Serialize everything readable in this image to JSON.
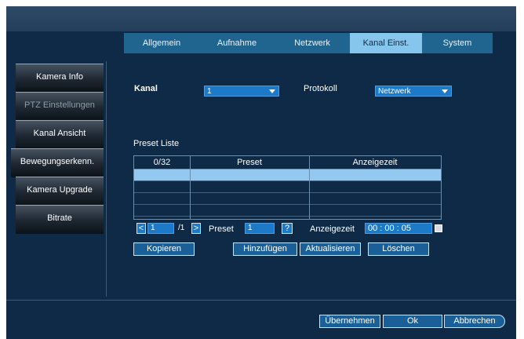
{
  "tabs": [
    {
      "label": "Allgemein",
      "active": false
    },
    {
      "label": "Aufnahme",
      "active": false
    },
    {
      "label": "Netzwerk",
      "active": false
    },
    {
      "label": "Kanal Einst.",
      "active": true
    },
    {
      "label": "System",
      "active": false
    }
  ],
  "sidebar": {
    "items": [
      {
        "label": "Kamera Info",
        "enabled": true
      },
      {
        "label": "PTZ Einstellungen",
        "enabled": false
      },
      {
        "label": "Kanal Ansicht",
        "enabled": true
      },
      {
        "label": "Bewegungserkenn.",
        "enabled": true
      },
      {
        "label": "Kamera Upgrade",
        "enabled": true
      },
      {
        "label": "Bitrate",
        "enabled": true
      }
    ]
  },
  "form": {
    "kanal_label": "Kanal",
    "kanal_value": "1",
    "protokoll_label": "Protokoll",
    "protokoll_value": "Netzwerk"
  },
  "preset_list": {
    "title": "Preset Liste",
    "headers": [
      "0/32",
      "Preset",
      "Anzeigezeit"
    ],
    "row_count": 4,
    "selected_row": 0
  },
  "pager": {
    "prev": "<",
    "page_value": "1",
    "total": "/1",
    "next": ">",
    "preset_label": "Preset",
    "preset_value": "1",
    "help": "?",
    "anzeigezeit_label": "Anzeigezeit",
    "time_value": "00 : 00 : 05"
  },
  "actions": {
    "kopieren": "Kopieren",
    "hinzufuegen": "Hinzufügen",
    "aktualisieren": "Aktualisieren",
    "loeschen": "Löschen"
  },
  "footer": {
    "apply": "Übernehmen",
    "ok": "Ok",
    "cancel": "Abbrechen"
  },
  "colors": {
    "background": "#0e2a46",
    "tab_bar": "#1f6590",
    "tab_active": "#87c6ec",
    "input_blue": "#1d7ac8",
    "selected_row": "#93c9f1"
  }
}
